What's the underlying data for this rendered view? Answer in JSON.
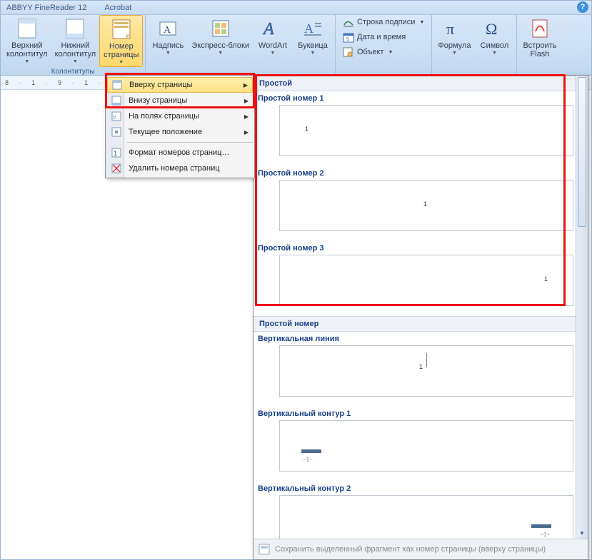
{
  "titlebar": {
    "addin1": "ABBYY FineReader 12",
    "addin2": "Acrobat"
  },
  "ribbon": {
    "group_hf": {
      "btn_top": {
        "label": "Верхний\nколонтитул"
      },
      "btn_bottom": {
        "label": "Нижний\nколонтитул"
      },
      "btn_pagenum": {
        "label": "Номер\nстраницы"
      },
      "caption": "Колонтитулы"
    },
    "group_text": {
      "btn_textbox": {
        "label": "Надпись"
      },
      "btn_quick": {
        "label": "Экспресс-блоки"
      },
      "btn_wordart": {
        "label": "WordArt"
      },
      "btn_dropcap": {
        "label": "Буквица"
      }
    },
    "group_links": {
      "sigline": "Строка подписи",
      "datetime": "Дата и время",
      "object": "Объект"
    },
    "group_sym": {
      "btn_formula": {
        "label": "Формула"
      },
      "btn_symbol": {
        "label": "Символ"
      }
    },
    "group_flash": {
      "btn_flash": {
        "label": "Встроить\nFlash"
      }
    }
  },
  "ruler": "8 · 1 · 9 · 1 · 10 · 1 · 11",
  "menu": {
    "top": "Вверху страницы",
    "bottom": "Внизу страницы",
    "margins": "На полях страницы",
    "current": "Текущее положение",
    "format": "Формат номеров страниц…",
    "remove": "Удалить номера страниц"
  },
  "gallery": {
    "cat1": "Простой",
    "i1": "Простой номер 1",
    "i2": "Простой номер 2",
    "i3": "Простой номер 3",
    "cat2": "Простой номер",
    "i4": "Вертикальная линия",
    "i5": "Вертикальный контур 1",
    "i6": "Вертикальный контур 2",
    "footer": "Сохранить выделенный фрагмент как номер страницы (вверху страницы)"
  }
}
